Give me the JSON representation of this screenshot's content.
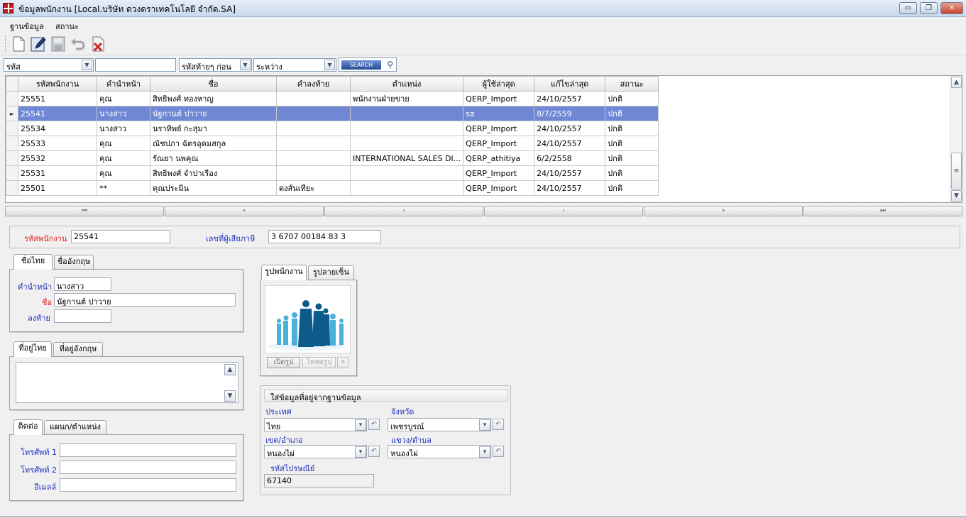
{
  "window": {
    "title": "ข้อมูลพนักงาน [Local.บริษัท ดวงดราเทคโนโลยี จำกัด.SA]",
    "minimize": "▭",
    "restore": "❐",
    "close": "✕"
  },
  "menu": {
    "items": [
      "ฐานข้อมูล",
      "สถานะ"
    ]
  },
  "toolbar": {
    "icons": [
      "new-document-icon",
      "edit-icon",
      "save-icon",
      "undo-icon",
      "delete-icon"
    ]
  },
  "filter": {
    "field": "รหัส",
    "value": "",
    "mode": "รหัสท้ายๆ ก่อน",
    "range": "ระหว่าง",
    "search_label": "SEARCH"
  },
  "grid": {
    "columns": [
      "รหัสพนักงาน",
      "คำนำหน้า",
      "ชื่อ",
      "คำลงท้าย",
      "ตำแหน่ง",
      "ผู้ใช้ล่าสุด",
      "แก้ไขล่าสุด",
      "สถานะ"
    ],
    "selected_index": 1,
    "rows": [
      [
        "25551",
        "คุณ",
        "สิทธิพงศ์ ทองหาญ",
        "",
        "พนักงานฝ่ายขาย",
        "QERP_Import",
        "24/10/2557",
        "ปกติ"
      ],
      [
        "25541",
        "นางสาว",
        "นัฐกานต์ ปาวาย",
        "",
        "",
        "sa",
        "8/7/2559",
        "ปกติ"
      ],
      [
        "25534",
        "นางสาว",
        "นราทิพย์ กะสุมา",
        "",
        "",
        "QERP_Import",
        "24/10/2557",
        "ปกติ"
      ],
      [
        "25533",
        "คุณ",
        "ณัชปภา ฉัตรอุดมสกุล",
        "",
        "",
        "QERP_Import",
        "24/10/2557",
        "ปกติ"
      ],
      [
        "25532",
        "คุณ",
        "รัณยา นพคุณ",
        "",
        "INTERNATIONAL SALES DI...",
        "QERP_athitiya",
        "6/2/2558",
        "ปกติ"
      ],
      [
        "25531",
        "คุณ",
        "สิทธิพงศ์ จำปาเรือง",
        "",
        "",
        "QERP_Import",
        "24/10/2557",
        "ปกติ"
      ],
      [
        "25501",
        "**",
        "คุณประมิน",
        "ดงสันเทียะ",
        "",
        "QERP_Import",
        "24/10/2557",
        "ปกติ"
      ]
    ]
  },
  "nav": {
    "first": "⏮",
    "prev_page": "«",
    "prev": "‹",
    "next": "›",
    "next_page": "»",
    "last": "⏭"
  },
  "header_fields": {
    "emp_code_label": "รหัสพนักงาน",
    "emp_code_value": "25541",
    "tax_id_label": "เลขที่ผู้เสียภาษี",
    "tax_id_value": "3 6707 00184 83 3"
  },
  "name_tabs": [
    "ชื่อไทย",
    "ชื่ออังกฤษ"
  ],
  "name_panel": {
    "prefix_label": "คำนำหน้า",
    "prefix_value": "นางสาว",
    "name_label": "ชื่อ",
    "name_value": "นัฐกานต์ ปาวาย",
    "suffix_label": "ลงท้าย",
    "suffix_value": ""
  },
  "address_tabs": [
    "ที่อยู่ไทย",
    "ที่อยู่อังกฤษ"
  ],
  "address_value": "",
  "contact_tabs": [
    "ติดต่อ",
    "แผนก/ตำแหน่ง"
  ],
  "contact_panel": {
    "phone1_label": "โทรศัพท์ 1",
    "phone1_value": "",
    "phone2_label": "โทรศัพท์ 2",
    "phone2_value": "",
    "email_label": "อีเมลล์",
    "email_value": ""
  },
  "photo_tabs": [
    "รูปพนักงาน",
    "รูปลายเซ็น"
  ],
  "photo_buttons": {
    "open": "เปิดรูป",
    "load": "โหลดรูป",
    "clear": "✕"
  },
  "geo_panel": {
    "title": "ใส่ข้อมูลที่อยู่จากฐานข้อมูล",
    "country_label": "ประเทศ",
    "country_value": "ไทย",
    "province_label": "จังหวัด",
    "province_value": "เพชรบูรณ์",
    "district_label": "เขต/อำเภอ",
    "district_value": "หนองไผ่",
    "subdistrict_label": "แขวง/ตำบล",
    "subdistrict_value": "หนองไผ่",
    "postcode_label": "รหัสไปรษณีย์",
    "postcode_value": "67140"
  }
}
